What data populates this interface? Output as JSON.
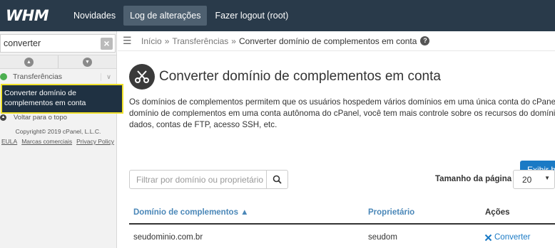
{
  "header": {
    "logo": "WHM",
    "nav": [
      "Novidades",
      "Log de alterações",
      "Fazer logout (root)"
    ]
  },
  "sidebar": {
    "search_value": "converter",
    "category": "Transferências",
    "selected_item": "Converter domínio de complementos em conta",
    "back_to_top": "Voltar para o topo",
    "copyright": "Copyright© 2019 cPanel, L.L.C.",
    "links": [
      "EULA",
      "Marcas comerciais",
      "Privacy Policy"
    ]
  },
  "breadcrumb": {
    "home": "Início",
    "sep": "»",
    "section": "Transferências",
    "current": "Converter domínio de complementos em conta"
  },
  "page": {
    "title": "Converter domínio de complementos em conta",
    "desc_line1": "Os domínios de complementos permitem que os usuários hospedem vários domínios em uma única conta do cPanel.",
    "desc_line2": "domínio de complementos em uma conta autônoma do cPanel, você tem mais controle sobre os recursos do domínio,",
    "desc_line3": "dados, contas de FTP, acesso SSH, etc.",
    "show_button": "Exibir h",
    "filter_placeholder": "Filtrar por domínio ou proprietário",
    "page_size_label": "Tamanho da página",
    "page_size_value": "20"
  },
  "table": {
    "headers": [
      "Domínio de complementos ▲",
      "Proprietário",
      "Ações"
    ],
    "rows": [
      {
        "domain": "seudominio.com.br",
        "owner": "seudom",
        "action": "Converter"
      }
    ]
  },
  "colors": {
    "topbar": "#293a4a",
    "accent": "#1a7ac5",
    "highlight": "#f0e12a"
  }
}
